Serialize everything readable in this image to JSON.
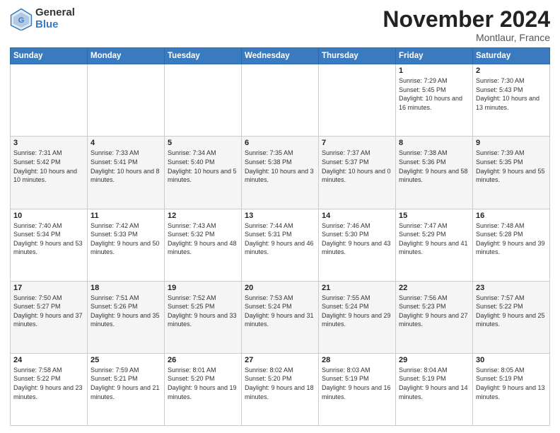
{
  "logo": {
    "general": "General",
    "blue": "Blue"
  },
  "header": {
    "month": "November 2024",
    "location": "Montlaur, France"
  },
  "days_of_week": [
    "Sunday",
    "Monday",
    "Tuesday",
    "Wednesday",
    "Thursday",
    "Friday",
    "Saturday"
  ],
  "weeks": [
    [
      {
        "day": "",
        "info": ""
      },
      {
        "day": "",
        "info": ""
      },
      {
        "day": "",
        "info": ""
      },
      {
        "day": "",
        "info": ""
      },
      {
        "day": "",
        "info": ""
      },
      {
        "day": "1",
        "info": "Sunrise: 7:29 AM\nSunset: 5:45 PM\nDaylight: 10 hours and 16 minutes."
      },
      {
        "day": "2",
        "info": "Sunrise: 7:30 AM\nSunset: 5:43 PM\nDaylight: 10 hours and 13 minutes."
      }
    ],
    [
      {
        "day": "3",
        "info": "Sunrise: 7:31 AM\nSunset: 5:42 PM\nDaylight: 10 hours and 10 minutes."
      },
      {
        "day": "4",
        "info": "Sunrise: 7:33 AM\nSunset: 5:41 PM\nDaylight: 10 hours and 8 minutes."
      },
      {
        "day": "5",
        "info": "Sunrise: 7:34 AM\nSunset: 5:40 PM\nDaylight: 10 hours and 5 minutes."
      },
      {
        "day": "6",
        "info": "Sunrise: 7:35 AM\nSunset: 5:38 PM\nDaylight: 10 hours and 3 minutes."
      },
      {
        "day": "7",
        "info": "Sunrise: 7:37 AM\nSunset: 5:37 PM\nDaylight: 10 hours and 0 minutes."
      },
      {
        "day": "8",
        "info": "Sunrise: 7:38 AM\nSunset: 5:36 PM\nDaylight: 9 hours and 58 minutes."
      },
      {
        "day": "9",
        "info": "Sunrise: 7:39 AM\nSunset: 5:35 PM\nDaylight: 9 hours and 55 minutes."
      }
    ],
    [
      {
        "day": "10",
        "info": "Sunrise: 7:40 AM\nSunset: 5:34 PM\nDaylight: 9 hours and 53 minutes."
      },
      {
        "day": "11",
        "info": "Sunrise: 7:42 AM\nSunset: 5:33 PM\nDaylight: 9 hours and 50 minutes."
      },
      {
        "day": "12",
        "info": "Sunrise: 7:43 AM\nSunset: 5:32 PM\nDaylight: 9 hours and 48 minutes."
      },
      {
        "day": "13",
        "info": "Sunrise: 7:44 AM\nSunset: 5:31 PM\nDaylight: 9 hours and 46 minutes."
      },
      {
        "day": "14",
        "info": "Sunrise: 7:46 AM\nSunset: 5:30 PM\nDaylight: 9 hours and 43 minutes."
      },
      {
        "day": "15",
        "info": "Sunrise: 7:47 AM\nSunset: 5:29 PM\nDaylight: 9 hours and 41 minutes."
      },
      {
        "day": "16",
        "info": "Sunrise: 7:48 AM\nSunset: 5:28 PM\nDaylight: 9 hours and 39 minutes."
      }
    ],
    [
      {
        "day": "17",
        "info": "Sunrise: 7:50 AM\nSunset: 5:27 PM\nDaylight: 9 hours and 37 minutes."
      },
      {
        "day": "18",
        "info": "Sunrise: 7:51 AM\nSunset: 5:26 PM\nDaylight: 9 hours and 35 minutes."
      },
      {
        "day": "19",
        "info": "Sunrise: 7:52 AM\nSunset: 5:25 PM\nDaylight: 9 hours and 33 minutes."
      },
      {
        "day": "20",
        "info": "Sunrise: 7:53 AM\nSunset: 5:24 PM\nDaylight: 9 hours and 31 minutes."
      },
      {
        "day": "21",
        "info": "Sunrise: 7:55 AM\nSunset: 5:24 PM\nDaylight: 9 hours and 29 minutes."
      },
      {
        "day": "22",
        "info": "Sunrise: 7:56 AM\nSunset: 5:23 PM\nDaylight: 9 hours and 27 minutes."
      },
      {
        "day": "23",
        "info": "Sunrise: 7:57 AM\nSunset: 5:22 PM\nDaylight: 9 hours and 25 minutes."
      }
    ],
    [
      {
        "day": "24",
        "info": "Sunrise: 7:58 AM\nSunset: 5:22 PM\nDaylight: 9 hours and 23 minutes."
      },
      {
        "day": "25",
        "info": "Sunrise: 7:59 AM\nSunset: 5:21 PM\nDaylight: 9 hours and 21 minutes."
      },
      {
        "day": "26",
        "info": "Sunrise: 8:01 AM\nSunset: 5:20 PM\nDaylight: 9 hours and 19 minutes."
      },
      {
        "day": "27",
        "info": "Sunrise: 8:02 AM\nSunset: 5:20 PM\nDaylight: 9 hours and 18 minutes."
      },
      {
        "day": "28",
        "info": "Sunrise: 8:03 AM\nSunset: 5:19 PM\nDaylight: 9 hours and 16 minutes."
      },
      {
        "day": "29",
        "info": "Sunrise: 8:04 AM\nSunset: 5:19 PM\nDaylight: 9 hours and 14 minutes."
      },
      {
        "day": "30",
        "info": "Sunrise: 8:05 AM\nSunset: 5:19 PM\nDaylight: 9 hours and 13 minutes."
      }
    ]
  ]
}
